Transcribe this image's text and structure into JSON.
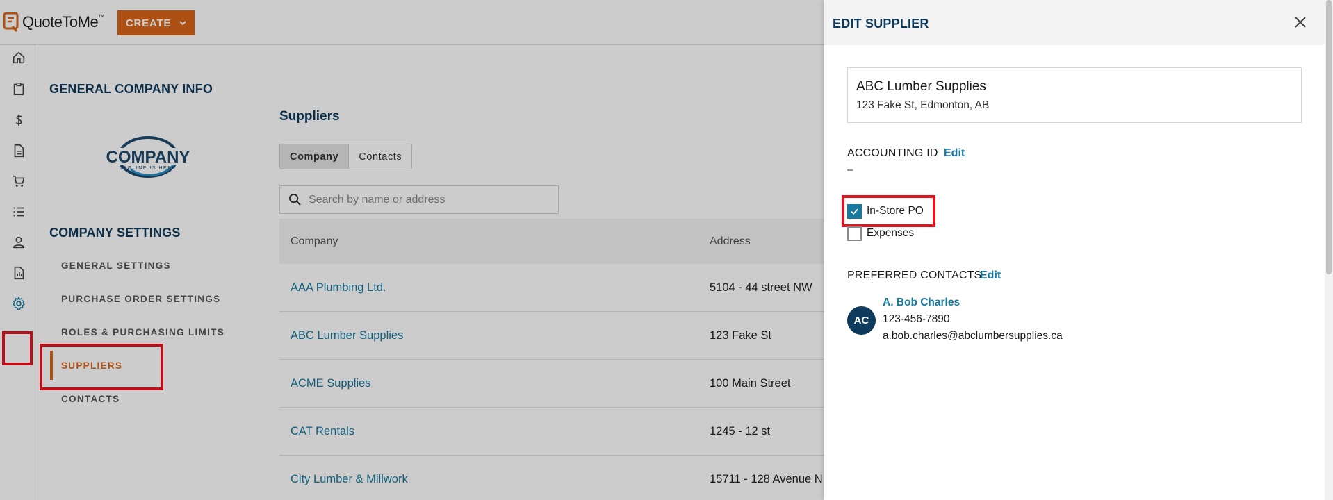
{
  "app": {
    "name": "QuoteToMe",
    "trademark": "™",
    "create_label": "CREATE"
  },
  "rail": {
    "icons": [
      "home-icon",
      "clipboard-icon",
      "dollar-icon",
      "document-icon",
      "cart-icon",
      "list-icon",
      "person-icon",
      "report-icon",
      "gear-icon"
    ]
  },
  "settings": {
    "general_info_title": "GENERAL COMPANY INFO",
    "company_logo_text": "COMPANY",
    "company_logo_tagline": "TAGLINE IS HERE",
    "company_settings_title": "COMPANY SETTINGS",
    "nav": [
      {
        "label": "GENERAL SETTINGS"
      },
      {
        "label": "PURCHASE ORDER SETTINGS"
      },
      {
        "label": "ROLES & PURCHASING LIMITS"
      },
      {
        "label": "SUPPLIERS",
        "active": true
      },
      {
        "label": "CONTACTS"
      }
    ]
  },
  "suppliers": {
    "title": "Suppliers",
    "tabs": [
      {
        "label": "Company",
        "active": true
      },
      {
        "label": "Contacts"
      }
    ],
    "search_placeholder": "Search by name or address",
    "columns": [
      "Company",
      "Address"
    ],
    "rows": [
      {
        "company": "AAA Plumbing Ltd.",
        "address": "5104 - 44 street NW"
      },
      {
        "company": "ABC Lumber Supplies",
        "address": "123 Fake St"
      },
      {
        "company": "ACME Supplies",
        "address": "100 Main Street"
      },
      {
        "company": "CAT Rentals",
        "address": "1245 - 12 st"
      },
      {
        "company": "City Lumber & Millwork",
        "address": "15711 - 128 Avenue N"
      }
    ]
  },
  "drawer": {
    "title": "EDIT SUPPLIER",
    "supplier_name": "ABC Lumber Supplies",
    "supplier_address": "123 Fake St, Edmonton, AB",
    "accounting_label": "ACCOUNTING ID",
    "accounting_edit": "Edit",
    "accounting_value": "–",
    "checkboxes": [
      {
        "label": "In-Store PO",
        "checked": true
      },
      {
        "label": "Expenses",
        "checked": false
      }
    ],
    "preferred_label": "PREFERRED CONTACTS",
    "preferred_edit": "Edit",
    "contact": {
      "initials": "AC",
      "name": "A. Bob Charles",
      "phone": "123-456-7890",
      "email": "a.bob.charles@abclumbersupplies.ca"
    }
  },
  "colors": {
    "brand_orange": "#d86418",
    "navy": "#0e3a5c",
    "link_teal": "#17799e",
    "highlight_red": "#e4141e"
  }
}
